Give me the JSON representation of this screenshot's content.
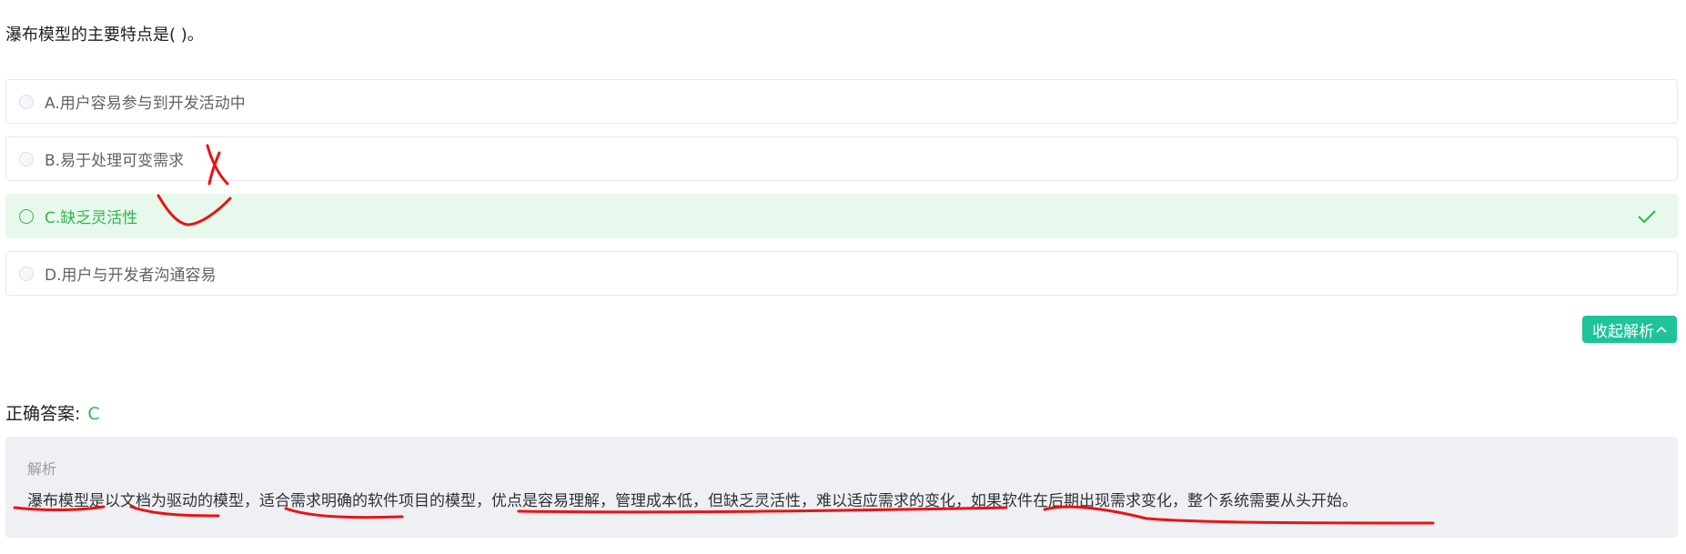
{
  "question": {
    "text": "瀑布模型的主要特点是(   )。"
  },
  "options": [
    {
      "label": "A.用户容易参与到开发活动中",
      "state": "normal"
    },
    {
      "label": "B.易于处理可变需求",
      "state": "normal"
    },
    {
      "label": "C.缺乏灵活性",
      "state": "correct"
    },
    {
      "label": "D.用户与开发者沟通容易",
      "state": "normal"
    }
  ],
  "toggle": {
    "label": "收起解析"
  },
  "answer": {
    "label": "正确答案:",
    "value": "C"
  },
  "analysis": {
    "title": "解析",
    "text": "瀑布模型是以文档为驱动的模型，适合需求明确的软件项目的模型，优点是容易理解，管理成本低，但缺乏灵活性，难以适应需求的变化，如果软件在后期出现需求变化，整个系统需要从头开始。"
  },
  "colors": {
    "correct_green": "#30b64b",
    "button_teal": "#1ec39a",
    "annotation_red": "#ee1111"
  },
  "icons": {
    "correct_marker": "check-icon",
    "toggle": "chevron-up-icon"
  }
}
